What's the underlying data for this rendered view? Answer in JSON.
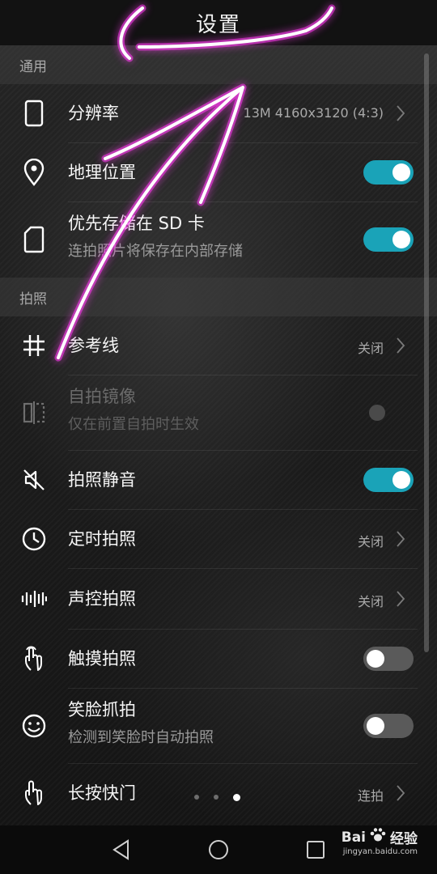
{
  "header": {
    "title": "设置"
  },
  "sections": {
    "general": "通用",
    "photo": "拍照"
  },
  "rows": {
    "resolution": {
      "label": "分辨率",
      "value": "13M 4160x3120 (4:3)",
      "icon": "phone-outline-icon"
    },
    "location": {
      "label": "地理位置",
      "toggle": true,
      "icon": "location-pin-icon"
    },
    "sd_storage": {
      "label": "优先存储在 SD 卡",
      "sub": "连拍照片将保存在内部存储",
      "toggle": true,
      "icon": "sd-card-icon"
    },
    "grid": {
      "label": "参考线",
      "value": "关闭",
      "icon": "grid-icon"
    },
    "mirror": {
      "label": "自拍镜像",
      "sub": "仅在前置自拍时生效",
      "enabled": false,
      "icon": "mirror-icon"
    },
    "mute": {
      "label": "拍照静音",
      "toggle": true,
      "icon": "speaker-mute-icon"
    },
    "timer": {
      "label": "定时拍照",
      "value": "关闭",
      "icon": "clock-icon"
    },
    "voice": {
      "label": "声控拍照",
      "value": "关闭",
      "icon": "sound-wave-icon"
    },
    "touch": {
      "label": "触摸拍照",
      "toggle": false,
      "icon": "touch-hand-icon"
    },
    "smile": {
      "label": "笑脸抓拍",
      "sub": "检测到笑脸时自动拍照",
      "toggle": false,
      "icon": "smile-face-icon"
    },
    "long_press": {
      "label": "长按快门",
      "value": "连拍",
      "icon": "long-press-hand-icon"
    }
  },
  "pager": {
    "count": 3,
    "active": 3
  },
  "colors": {
    "accent": "#1aa3b8",
    "annotation": "#ff3df0"
  },
  "watermark": {
    "brand": "Bai",
    "brand_suffix": "经验",
    "url": "jingyan.baidu.com"
  }
}
